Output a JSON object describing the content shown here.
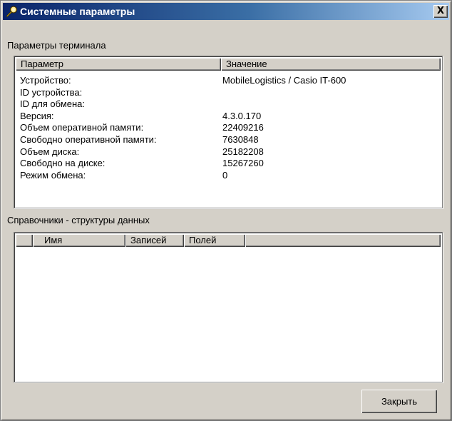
{
  "window": {
    "title": "Системные параметры",
    "close_label": "X"
  },
  "terminal": {
    "section_label": "Параметры терминала",
    "columns": [
      "Параметр",
      "Значение"
    ],
    "rows": [
      {
        "name": "Устройство:",
        "value": "MobileLogistics / Casio IT-600"
      },
      {
        "name": "ID устройства:",
        "value": ""
      },
      {
        "name": "ID для обмена:",
        "value": ""
      },
      {
        "name": "Версия:",
        "value": "4.3.0.170"
      },
      {
        "name": "Объем оперативной памяти:",
        "value": "22409216"
      },
      {
        "name": "Свободно оперативной памяти:",
        "value": "7630848"
      },
      {
        "name": "Объем диска:",
        "value": "25182208"
      },
      {
        "name": "Свободно на диске:",
        "value": "15267260"
      },
      {
        "name": "Режим обмена:",
        "value": "0"
      }
    ]
  },
  "catalogs": {
    "section_label": "Справочники - структуры данных",
    "columns": [
      "",
      "Имя",
      "Записей",
      "Полей"
    ]
  },
  "footer": {
    "close_button": "Закрыть"
  }
}
